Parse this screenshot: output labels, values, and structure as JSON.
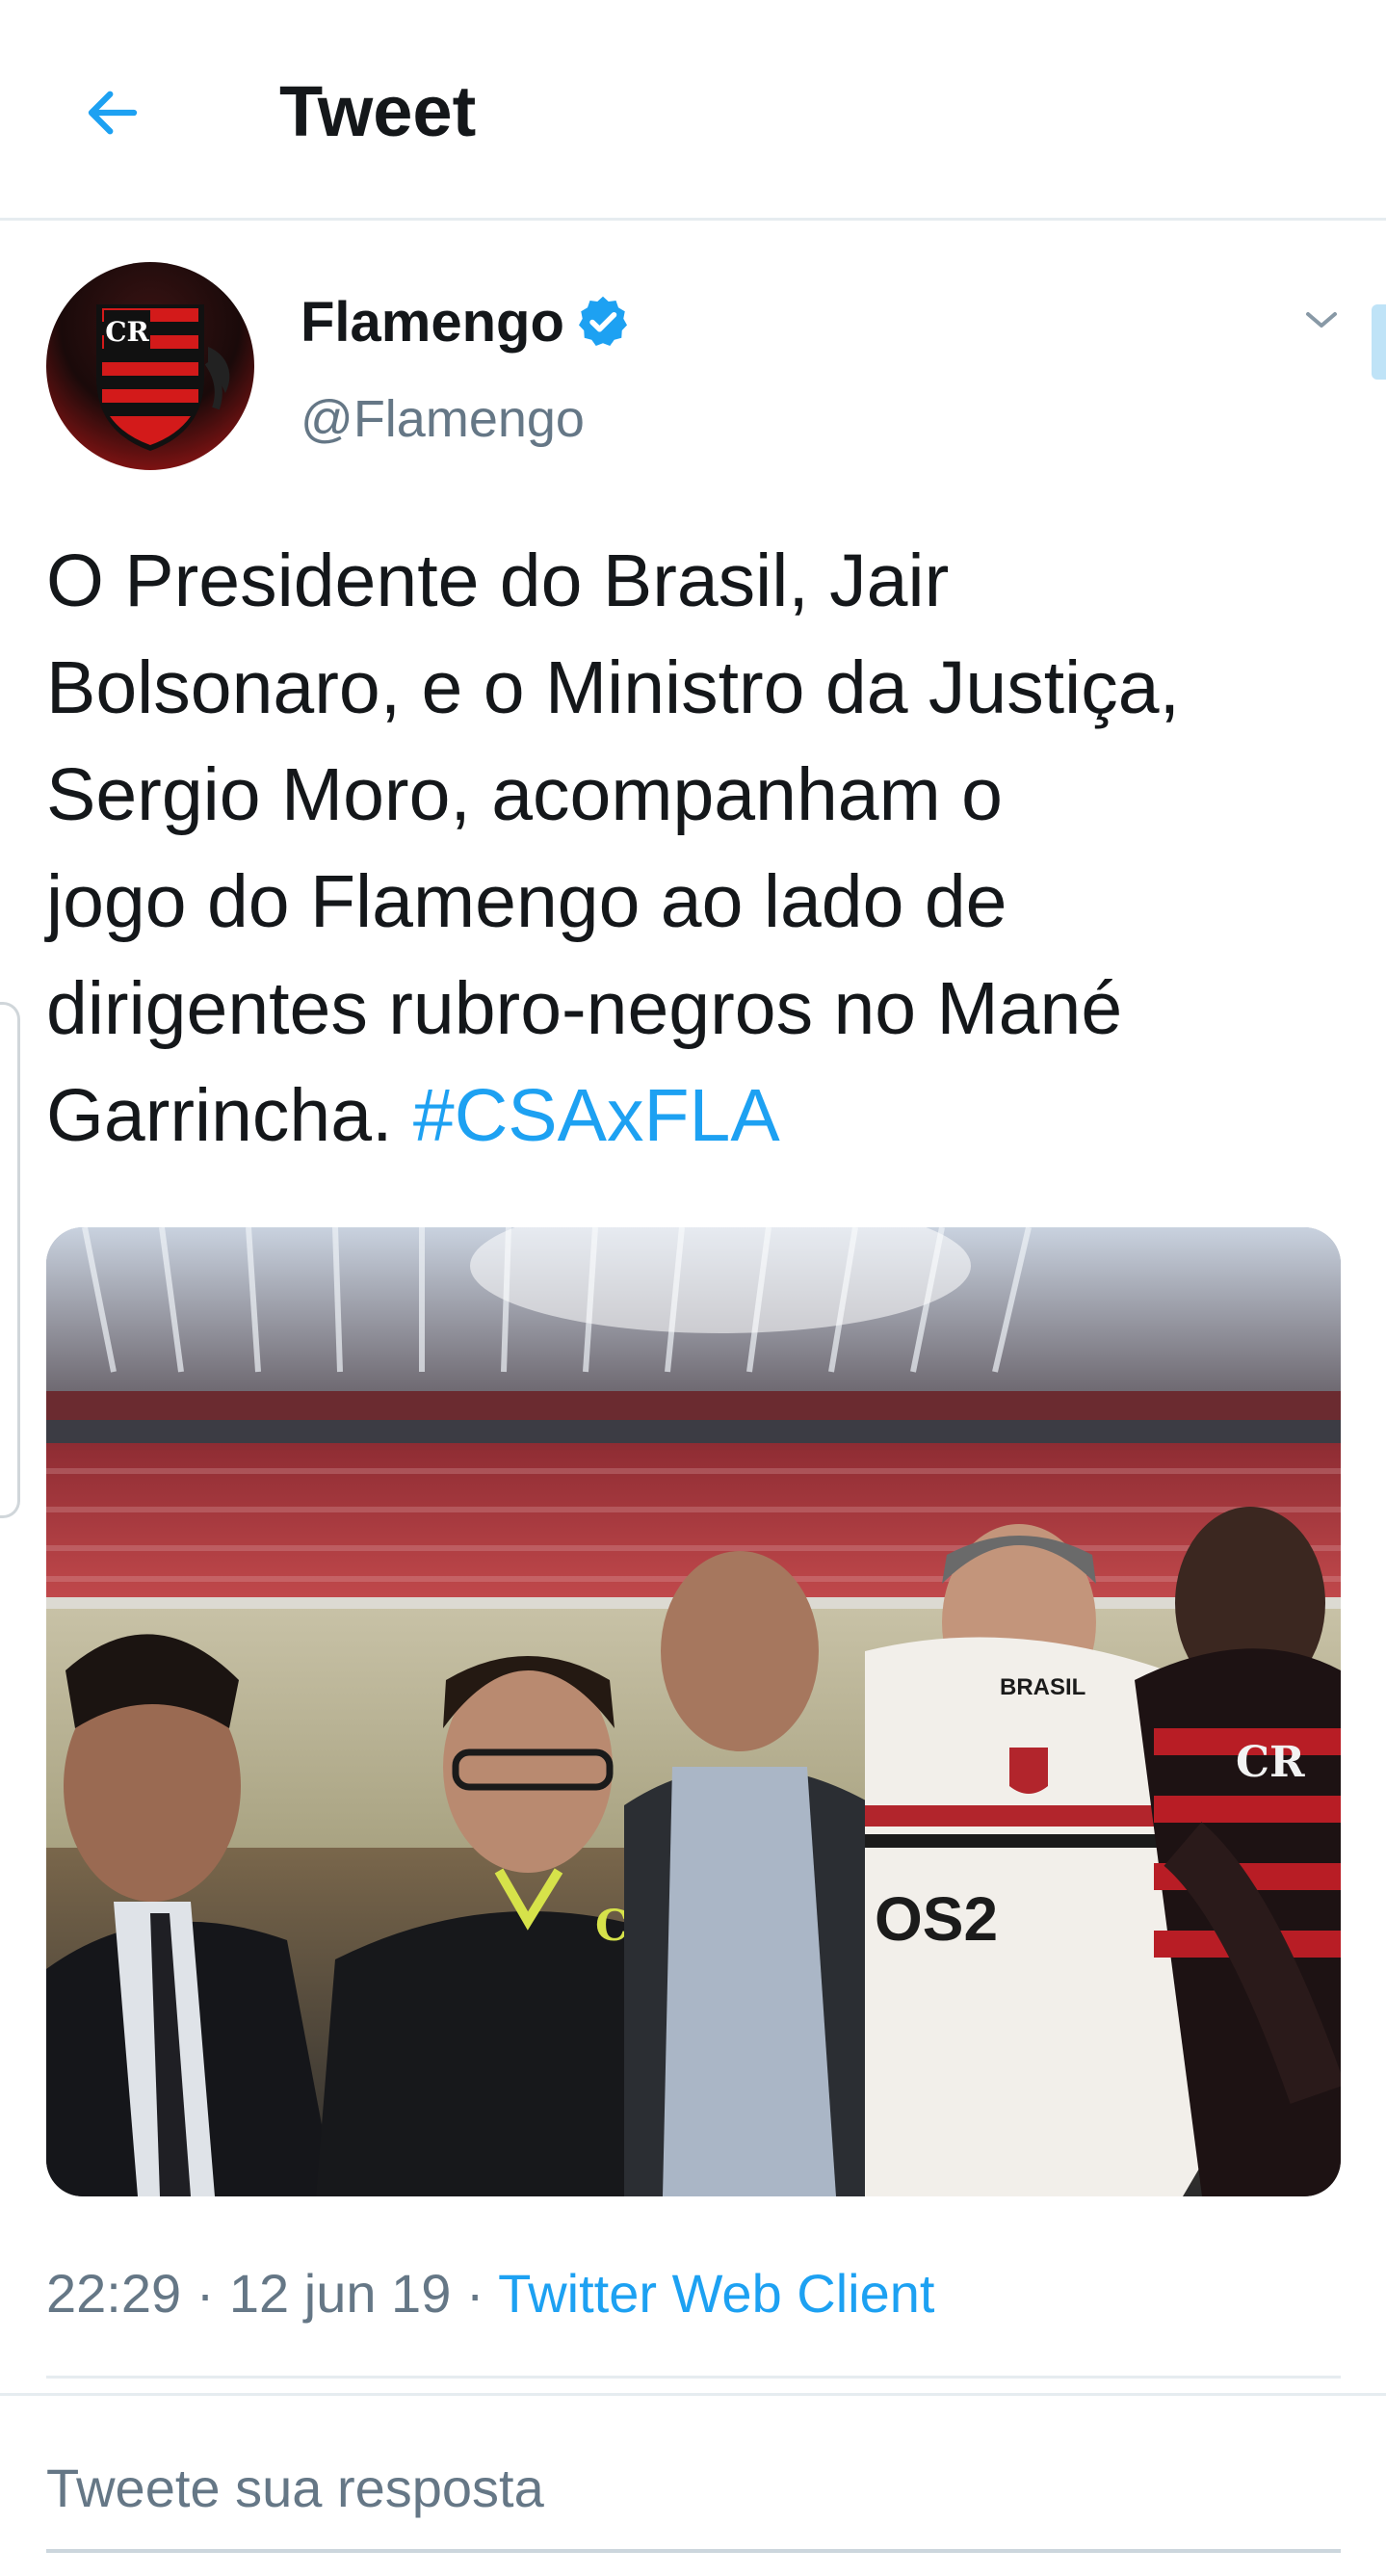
{
  "header": {
    "title": "Tweet",
    "back_icon": "arrow-left-icon"
  },
  "author": {
    "display_name": "Flamengo",
    "handle": "@Flamengo",
    "verified": true,
    "verified_icon": "verified-badge-icon",
    "menu_icon": "chevron-down-icon"
  },
  "tweet": {
    "lines": [
      "O Presidente do Brasil, Jair",
      "Bolsonaro, e o Ministro da Justiça,",
      "Sergio Moro, acompanham o",
      "jogo do Flamengo ao lado de",
      "dirigentes rubro-negros no Mané",
      "Garrincha. "
    ],
    "hashtag": "#CSAxFLA",
    "photo": {
      "jersey_sponsor": "BRASIL",
      "jersey_number": "OS2"
    },
    "time": "22:29",
    "separator": " · ",
    "date": "12 jun 19",
    "client": "Twitter Web Client"
  },
  "reply": {
    "placeholder": "Tweete sua resposta"
  },
  "colors": {
    "accent": "#1da1f2",
    "text_primary": "#14171a",
    "text_secondary": "#657786",
    "divider": "#e6ecf0",
    "flamengo_red": "#c8102e"
  }
}
